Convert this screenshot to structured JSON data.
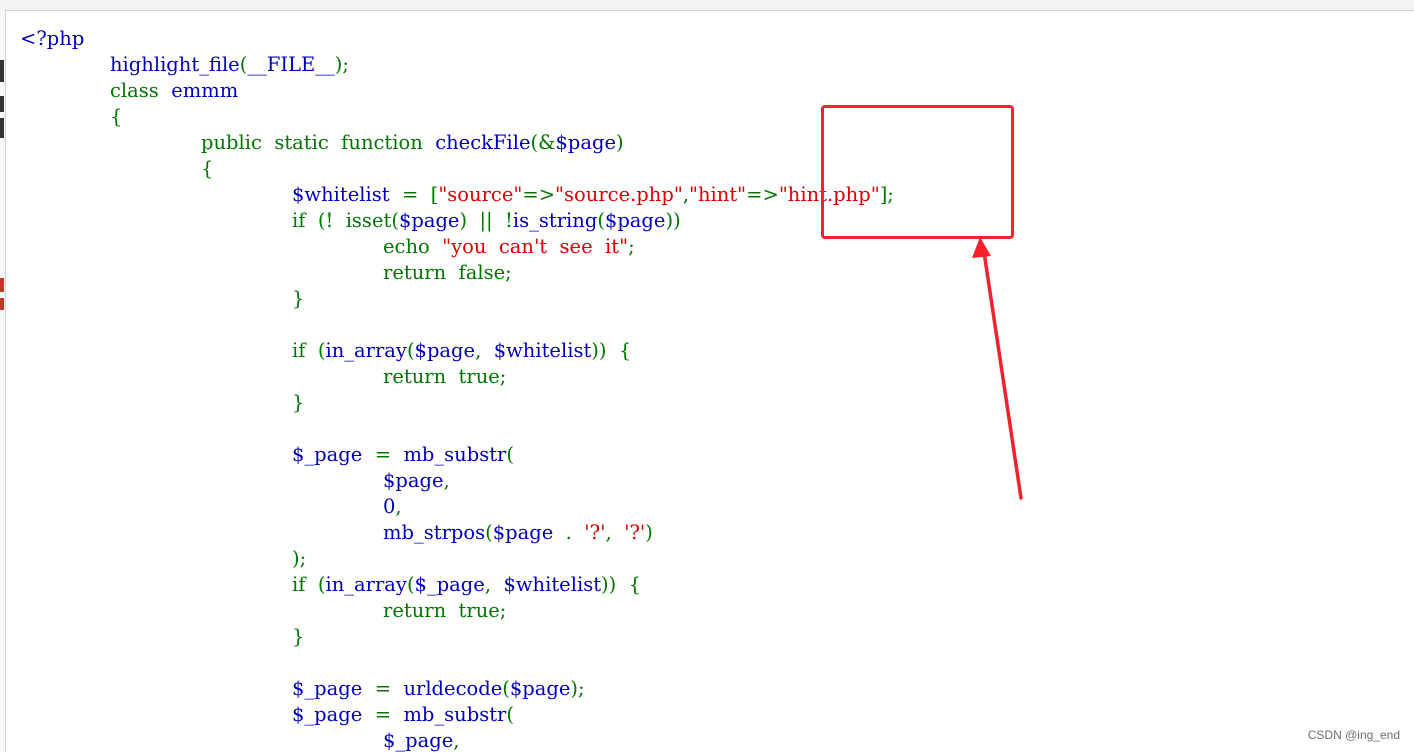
{
  "code_lines": [
    {
      "indent": 0,
      "tokens": [
        {
          "t": "<?php",
          "c": "html"
        }
      ]
    },
    {
      "indent": 1,
      "tokens": [
        {
          "t": "highlight_file",
          "c": "html"
        },
        {
          "t": "(",
          "c": "php"
        },
        {
          "t": "__FILE__",
          "c": "html"
        },
        {
          "t": ");",
          "c": "php"
        }
      ]
    },
    {
      "indent": 1,
      "tokens": [
        {
          "t": "class  ",
          "c": "php"
        },
        {
          "t": "emmm",
          "c": "html"
        }
      ]
    },
    {
      "indent": 1,
      "tokens": [
        {
          "t": "{",
          "c": "php"
        }
      ]
    },
    {
      "indent": 2,
      "tokens": [
        {
          "t": "public  static  function  ",
          "c": "php"
        },
        {
          "t": "checkFile",
          "c": "html"
        },
        {
          "t": "(&",
          "c": "php"
        },
        {
          "t": "$page",
          "c": "html"
        },
        {
          "t": ")",
          "c": "php"
        }
      ]
    },
    {
      "indent": 2,
      "tokens": [
        {
          "t": "{",
          "c": "php"
        }
      ]
    },
    {
      "indent": 3,
      "tokens": [
        {
          "t": "$whitelist  ",
          "c": "html"
        },
        {
          "t": "=  [",
          "c": "php"
        },
        {
          "t": "\"source\"",
          "c": "str"
        },
        {
          "t": "=>",
          "c": "php"
        },
        {
          "t": "\"source.php\"",
          "c": "str"
        },
        {
          "t": ",",
          "c": "php"
        },
        {
          "t": "\"hint\"",
          "c": "str"
        },
        {
          "t": "=>",
          "c": "php"
        },
        {
          "t": "\"hint.php\"",
          "c": "str"
        },
        {
          "t": "];",
          "c": "php"
        }
      ]
    },
    {
      "indent": 3,
      "tokens": [
        {
          "t": "if  (!  isset(",
          "c": "php"
        },
        {
          "t": "$page",
          "c": "html"
        },
        {
          "t": ")  ||  !",
          "c": "php"
        },
        {
          "t": "is_string",
          "c": "html"
        },
        {
          "t": "(",
          "c": "php"
        },
        {
          "t": "$page",
          "c": "html"
        },
        {
          "t": "))",
          "c": "php"
        }
      ]
    },
    {
      "indent": 4,
      "tokens": [
        {
          "t": "echo  ",
          "c": "php"
        },
        {
          "t": "\"you  can't  see  it\"",
          "c": "str"
        },
        {
          "t": ";",
          "c": "php"
        }
      ]
    },
    {
      "indent": 4,
      "tokens": [
        {
          "t": "return  false;",
          "c": "php"
        }
      ]
    },
    {
      "indent": 3,
      "tokens": [
        {
          "t": "}",
          "c": "php"
        }
      ]
    },
    {
      "indent": 0,
      "tokens": []
    },
    {
      "indent": 3,
      "tokens": [
        {
          "t": "if  (",
          "c": "php"
        },
        {
          "t": "in_array",
          "c": "html"
        },
        {
          "t": "(",
          "c": "php"
        },
        {
          "t": "$page",
          "c": "html"
        },
        {
          "t": ",  ",
          "c": "php"
        },
        {
          "t": "$whitelist",
          "c": "html"
        },
        {
          "t": "))  {",
          "c": "php"
        }
      ]
    },
    {
      "indent": 4,
      "tokens": [
        {
          "t": "return  true;",
          "c": "php"
        }
      ]
    },
    {
      "indent": 3,
      "tokens": [
        {
          "t": "}",
          "c": "php"
        }
      ]
    },
    {
      "indent": 0,
      "tokens": []
    },
    {
      "indent": 3,
      "tokens": [
        {
          "t": "$_page  ",
          "c": "html"
        },
        {
          "t": "=  ",
          "c": "php"
        },
        {
          "t": "mb_substr",
          "c": "html"
        },
        {
          "t": "(",
          "c": "php"
        }
      ]
    },
    {
      "indent": 4,
      "tokens": [
        {
          "t": "$page",
          "c": "html"
        },
        {
          "t": ",",
          "c": "php"
        }
      ]
    },
    {
      "indent": 4,
      "tokens": [
        {
          "t": "0",
          "c": "html"
        },
        {
          "t": ",",
          "c": "php"
        }
      ]
    },
    {
      "indent": 4,
      "tokens": [
        {
          "t": "mb_strpos",
          "c": "html"
        },
        {
          "t": "(",
          "c": "php"
        },
        {
          "t": "$page  ",
          "c": "html"
        },
        {
          "t": ".  ",
          "c": "php"
        },
        {
          "t": "'?'",
          "c": "str"
        },
        {
          "t": ",  ",
          "c": "php"
        },
        {
          "t": "'?'",
          "c": "str"
        },
        {
          "t": ")",
          "c": "php"
        }
      ]
    },
    {
      "indent": 3,
      "tokens": [
        {
          "t": ");",
          "c": "php"
        }
      ]
    },
    {
      "indent": 3,
      "tokens": [
        {
          "t": "if  (",
          "c": "php"
        },
        {
          "t": "in_array",
          "c": "html"
        },
        {
          "t": "(",
          "c": "php"
        },
        {
          "t": "$_page",
          "c": "html"
        },
        {
          "t": ",  ",
          "c": "php"
        },
        {
          "t": "$whitelist",
          "c": "html"
        },
        {
          "t": "))  {",
          "c": "php"
        }
      ]
    },
    {
      "indent": 4,
      "tokens": [
        {
          "t": "return  true;",
          "c": "php"
        }
      ]
    },
    {
      "indent": 3,
      "tokens": [
        {
          "t": "}",
          "c": "php"
        }
      ]
    },
    {
      "indent": 0,
      "tokens": []
    },
    {
      "indent": 3,
      "tokens": [
        {
          "t": "$_page  ",
          "c": "html"
        },
        {
          "t": "=  ",
          "c": "php"
        },
        {
          "t": "urldecode",
          "c": "html"
        },
        {
          "t": "(",
          "c": "php"
        },
        {
          "t": "$page",
          "c": "html"
        },
        {
          "t": ");",
          "c": "php"
        }
      ]
    },
    {
      "indent": 3,
      "tokens": [
        {
          "t": "$_page  ",
          "c": "html"
        },
        {
          "t": "=  ",
          "c": "php"
        },
        {
          "t": "mb_substr",
          "c": "html"
        },
        {
          "t": "(",
          "c": "php"
        }
      ]
    },
    {
      "indent": 4,
      "tokens": [
        {
          "t": "$_page",
          "c": "html"
        },
        {
          "t": ",",
          "c": "php"
        }
      ]
    }
  ],
  "colors": {
    "html": "#0000bb",
    "php": "#007700",
    "str": "#dd0000",
    "annotation": "#f4222d"
  },
  "watermark": "CSDN @ing_end"
}
